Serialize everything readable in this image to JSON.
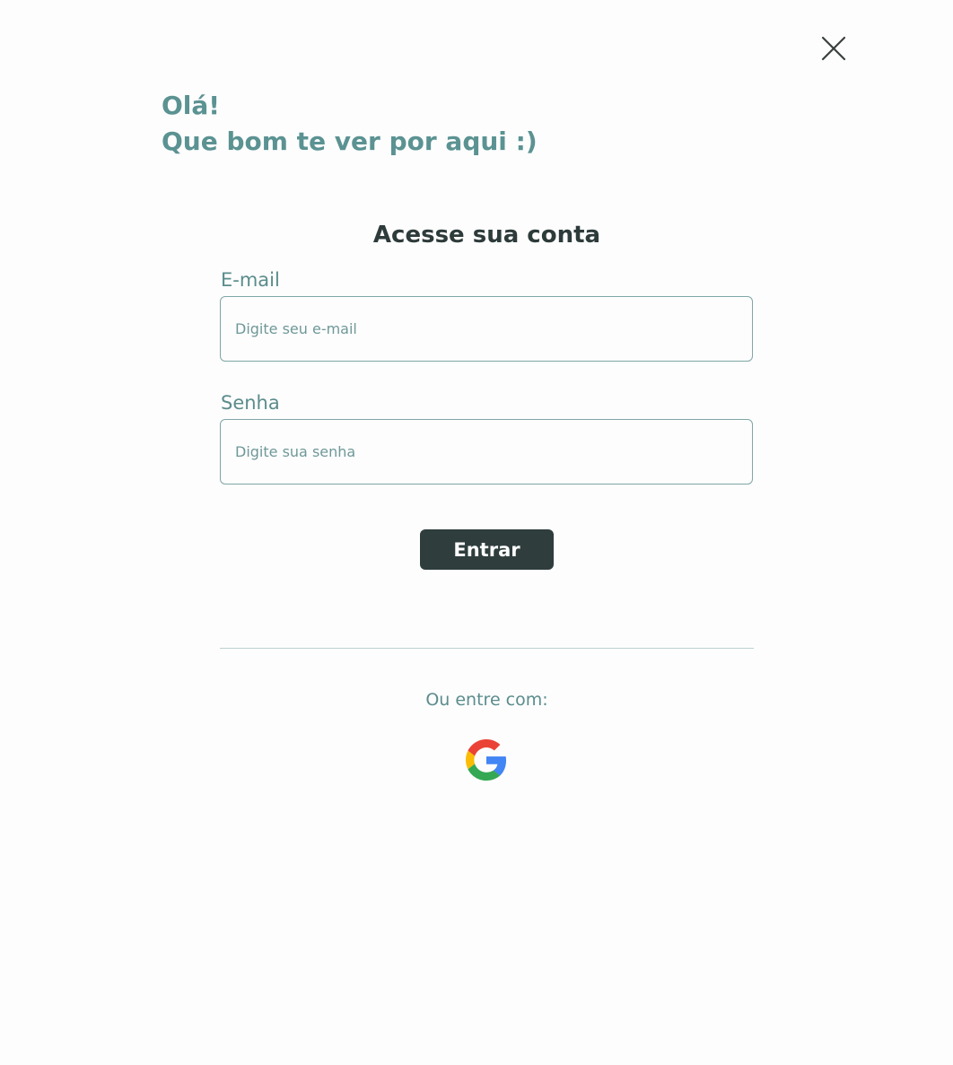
{
  "header": {
    "greeting_line1": "Olá!",
    "greeting_line2": "Que bom te ver por aqui :)",
    "close_icon": "close-icon"
  },
  "login": {
    "title": "Acesse sua conta",
    "email": {
      "label": "E-mail",
      "placeholder": "Digite seu e-mail",
      "value": ""
    },
    "password": {
      "label": "Senha",
      "placeholder": "Digite sua senha",
      "value": ""
    },
    "submit_label": "Entrar"
  },
  "social": {
    "label": "Ou entre com:",
    "providers": [
      {
        "name": "google",
        "icon": "google-icon"
      }
    ]
  },
  "colors": {
    "accent": "#5b9292",
    "button_bg": "#2f3d3d",
    "heading": "#2d3b3a",
    "input_border": "#7fa6a6",
    "divider": "#b9d1d1",
    "background": "#fdfdfd"
  }
}
